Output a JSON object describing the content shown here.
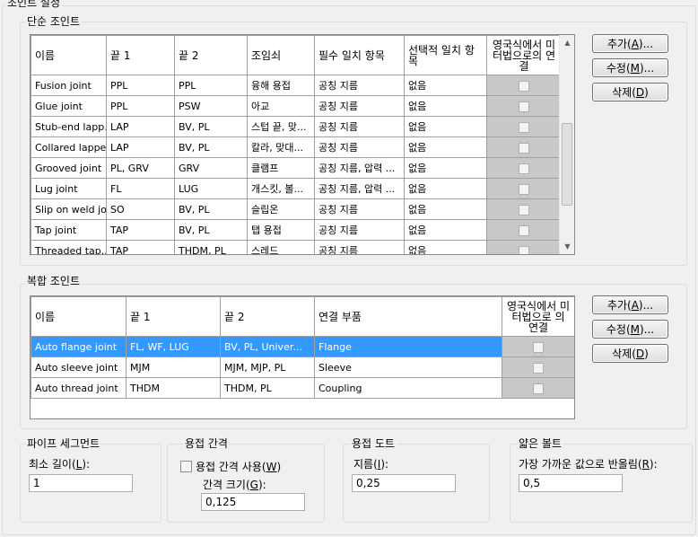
{
  "window": {
    "title": "조인트 설정"
  },
  "simple": {
    "legend": "단순 조인트",
    "headers": [
      "이름",
      "끝 1",
      "끝 2",
      "조임쇠",
      "필수 일치 항목",
      "선택적 일치 항목",
      "영국식에서 미터법으로의 연결"
    ],
    "rows": [
      [
        "Fusion joint",
        "PPL",
        "PPL",
        "융해 용접",
        "공칭 지름",
        "없음"
      ],
      [
        "Glue joint",
        "PPL",
        "PSW",
        "아교",
        "공칭 지름",
        "없음"
      ],
      [
        "Stub-end lapp...",
        "LAP",
        "BV, PL",
        "스텁 끝, 맞...",
        "공칭 지름",
        "없음"
      ],
      [
        "Collared lappe...",
        "LAP",
        "BV, PL",
        "칼라, 맞대...",
        "공칭 지름",
        "없음"
      ],
      [
        "Grooved joint",
        "PL, GRV",
        "GRV",
        "클램프",
        "공칭 지름, 압력 ...",
        "없음"
      ],
      [
        "Lug joint",
        "FL",
        "LUG",
        "개스킷, 볼...",
        "공칭 지름, 압력 ...",
        "없음"
      ],
      [
        "Slip on weld jo...",
        "SO",
        "BV, PL",
        "슬립온",
        "공칭 지름",
        "없음"
      ],
      [
        "Tap joint",
        "TAP",
        "BV, PL",
        "탭 용접",
        "공칭 지름",
        "없음"
      ],
      [
        "Threaded tap...",
        "TAP",
        "THDM, PL",
        "스레드",
        "공칭 지름",
        "없음"
      ]
    ],
    "buttons": {
      "add": "추가(",
      "add_key": "A",
      "add_end": ")...",
      "edit": "수정(",
      "edit_key": "M",
      "edit_end": ")...",
      "del": "삭제(",
      "del_key": "D",
      "del_end": ")"
    }
  },
  "compound": {
    "legend": "복합 조인트",
    "headers": [
      "이름",
      "끝 1",
      "끝 2",
      "연결 부품",
      "영국식에서 미터법으로 의 연결"
    ],
    "rows": [
      [
        "Auto flange joint",
        "FL, WF, LUG",
        "BV, PL, Univer...",
        "Flange"
      ],
      [
        "Auto sleeve joint",
        "MJM",
        "MJM, MJP, PL",
        "Sleeve"
      ],
      [
        "Auto thread joint",
        "THDM",
        "THDM, PL",
        "Coupling"
      ]
    ],
    "selected_row": "Auto flange joint",
    "buttons": {
      "add": "추가(",
      "add_key": "A",
      "add_end": ")...",
      "edit": "수정(",
      "edit_key": "M",
      "edit_end": ")...",
      "del": "삭제(",
      "del_key": "D",
      "del_end": ")"
    }
  },
  "pipe_segment": {
    "legend": "파이프 세그먼트",
    "label": "최소 길이(",
    "key": "L",
    "label_end": "):",
    "value": "1"
  },
  "weld_gap": {
    "legend": "용접 간격",
    "checkbox_label": "용접 간격 사용(",
    "checkbox_key": "W",
    "checkbox_end": ")",
    "checked": false,
    "label": "간격 크기(",
    "key": "G",
    "label_end": "):",
    "value": "0,125"
  },
  "weld_dot": {
    "legend": "용접 도트",
    "label": "지름(",
    "key": "I",
    "label_end": "):",
    "value": "0,25"
  },
  "bolt": {
    "legend": "얇은 볼트",
    "label": "가장 가까운 값으로 반올림(",
    "key": "R",
    "label_end": "):",
    "value": "0,5"
  }
}
